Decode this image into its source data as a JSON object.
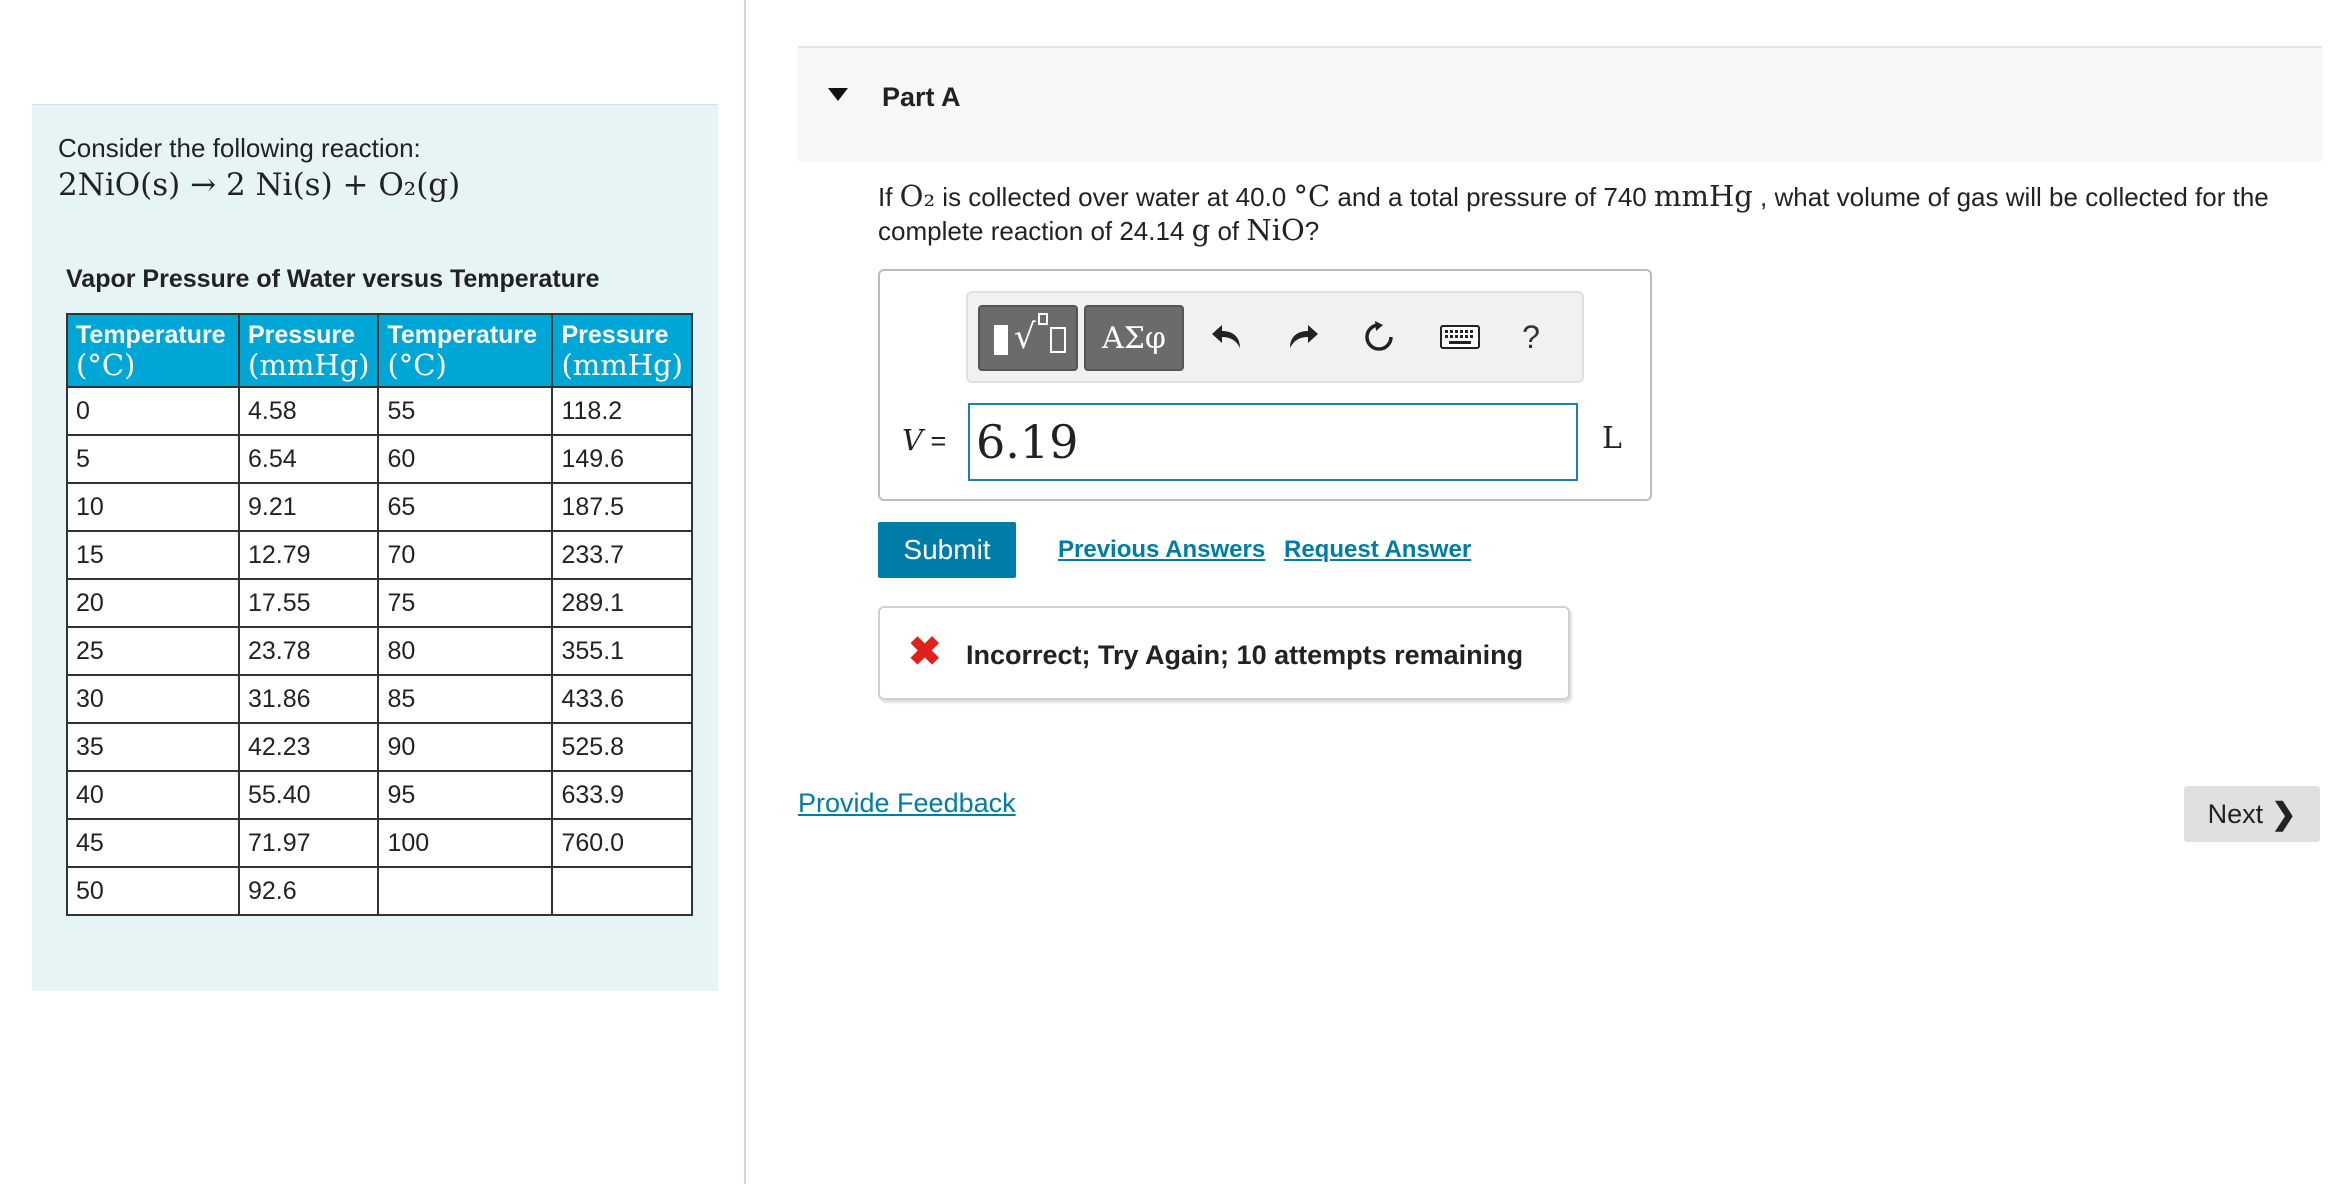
{
  "left": {
    "intro": "Consider the following reaction:",
    "reaction": "2NiO(s) → 2 Ni(s) + O₂(g)",
    "table_title": "Vapor Pressure of Water versus Temperature",
    "table": {
      "headers": [
        {
          "word": "Temperature",
          "unit": "(°C)"
        },
        {
          "word": "Pressure",
          "unit": "(mmHg)"
        },
        {
          "word": "Temperature",
          "unit": "(°C)"
        },
        {
          "word": "Pressure",
          "unit": "(mmHg)"
        }
      ],
      "rows": [
        [
          "0",
          "4.58",
          "55",
          "118.2"
        ],
        [
          "5",
          "6.54",
          "60",
          "149.6"
        ],
        [
          "10",
          "9.21",
          "65",
          "187.5"
        ],
        [
          "15",
          "12.79",
          "70",
          "233.7"
        ],
        [
          "20",
          "17.55",
          "75",
          "289.1"
        ],
        [
          "25",
          "23.78",
          "80",
          "355.1"
        ],
        [
          "30",
          "31.86",
          "85",
          "433.6"
        ],
        [
          "35",
          "42.23",
          "90",
          "525.8"
        ],
        [
          "40",
          "55.40",
          "95",
          "633.9"
        ],
        [
          "45",
          "71.97",
          "100",
          "760.0"
        ],
        [
          "50",
          "92.6",
          "",
          ""
        ]
      ]
    }
  },
  "part": {
    "title": "Part A",
    "question": {
      "p1": "If ",
      "o2": "O₂",
      "p2": " is collected over water at 40.0 ",
      "degc": "°C",
      "p3": " and a total pressure of 740 ",
      "mmhg": "mmHg",
      "p4": " , what volume of gas will be collected for the complete reaction of 24.14 ",
      "g": "g",
      "p5": " of ",
      "nio": "NiO",
      "p6": "?"
    }
  },
  "toolbar": {
    "greek_label": "ΑΣφ",
    "help_label": "?",
    "icons": [
      "templates-icon",
      "greek-letters-icon",
      "undo-icon",
      "redo-icon",
      "reset-icon",
      "keyboard-icon",
      "help-icon"
    ]
  },
  "answer": {
    "var_name": "V",
    "equals": " = ",
    "value": "6.19",
    "unit": "L"
  },
  "actions": {
    "submit": "Submit",
    "previous_answers": "Previous Answers",
    "request_answer": "Request Answer"
  },
  "feedback": {
    "icon": "✖",
    "message": "Incorrect; Try Again; 10 attempts remaining",
    "color": "#e0201b"
  },
  "footer": {
    "provide_feedback": "Provide Feedback",
    "next": "Next"
  },
  "colors": {
    "accent": "#007da6",
    "table_header": "#00a6d6",
    "left_panel_bg": "#e6f4f6"
  }
}
